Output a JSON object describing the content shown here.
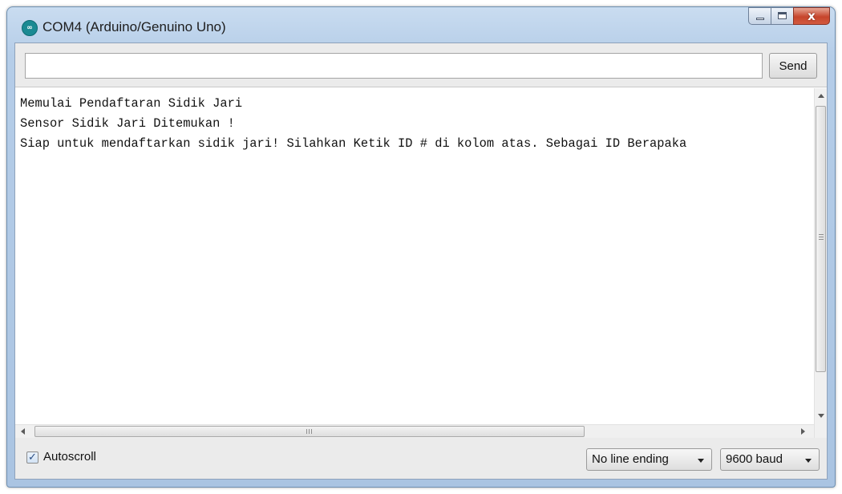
{
  "window": {
    "title": "COM4 (Arduino/Genuino Uno)",
    "app_icon_glyph": "∞",
    "close_glyph": "x"
  },
  "send": {
    "input_value": "",
    "button_label": "Send"
  },
  "output": {
    "lines": [
      "Memulai Pendaftaran Sidik Jari",
      "Sensor Sidik Jari Ditemukan !",
      "Siap untuk mendaftarkan sidik jari! Silahkan Ketik ID # di kolom atas. Sebagai ID Berapaka"
    ]
  },
  "status": {
    "autoscroll_label": "Autoscroll",
    "autoscroll_checked": true,
    "check_glyph": "✓",
    "line_ending": "No line ending",
    "baud_rate": "9600 baud"
  },
  "colors": {
    "title_gradient_top": "#c9dcf0",
    "close_button": "#c6452c",
    "app_icon": "#1b8a93",
    "client_background": "#ebebeb"
  },
  "icons": {
    "app": "arduino-icon",
    "minimize": "minimize-icon",
    "maximize": "maximize-icon",
    "close": "close-icon",
    "checkbox": "checkmark-icon",
    "dropdown": "chevron-down-icon"
  }
}
